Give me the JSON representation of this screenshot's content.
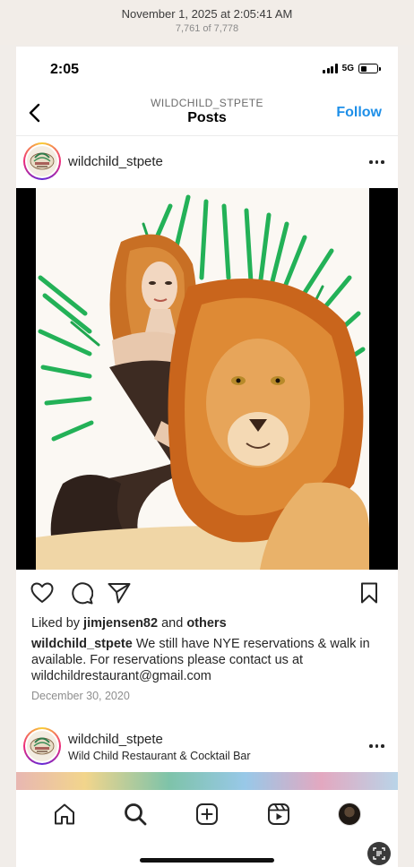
{
  "viewer": {
    "date": "November 1, 2025 at 2:05:41 AM",
    "count": "7,761 of 7,778"
  },
  "status_bar": {
    "time": "2:05",
    "network": "5G",
    "battery_level": 0.4
  },
  "nav": {
    "account": "WILDCHILD_STPETE",
    "title": "Posts",
    "follow_label": "Follow"
  },
  "post": {
    "username": "wildchild_stpete",
    "liked_prefix": "Liked by ",
    "liked_user": "jimjensen82",
    "liked_middle": " and ",
    "liked_others": "others",
    "caption_user": "wildchild_stpete",
    "caption_text": " We still have NYE reservations & walk in available. For reservations please contact us at wildchildrestaurant@gmail.com",
    "date": "December 30, 2020"
  },
  "next_post": {
    "username": "wildchild_stpete",
    "subtitle": "Wild Child Restaurant & Cocktail Bar"
  },
  "icons": {
    "back": "chevron-left-icon",
    "more": "more-horizontal-icon",
    "like": "heart-icon",
    "comment": "comment-icon",
    "share": "send-icon",
    "save": "bookmark-icon",
    "home": "home-icon",
    "search": "search-icon",
    "create": "plus-square-icon",
    "reels": "reels-icon",
    "profile": "profile-avatar",
    "lens": "visual-lookup-icon"
  },
  "colors": {
    "accent": "#1e8fe8",
    "text": "#262626",
    "muted": "#8e8e8e"
  }
}
